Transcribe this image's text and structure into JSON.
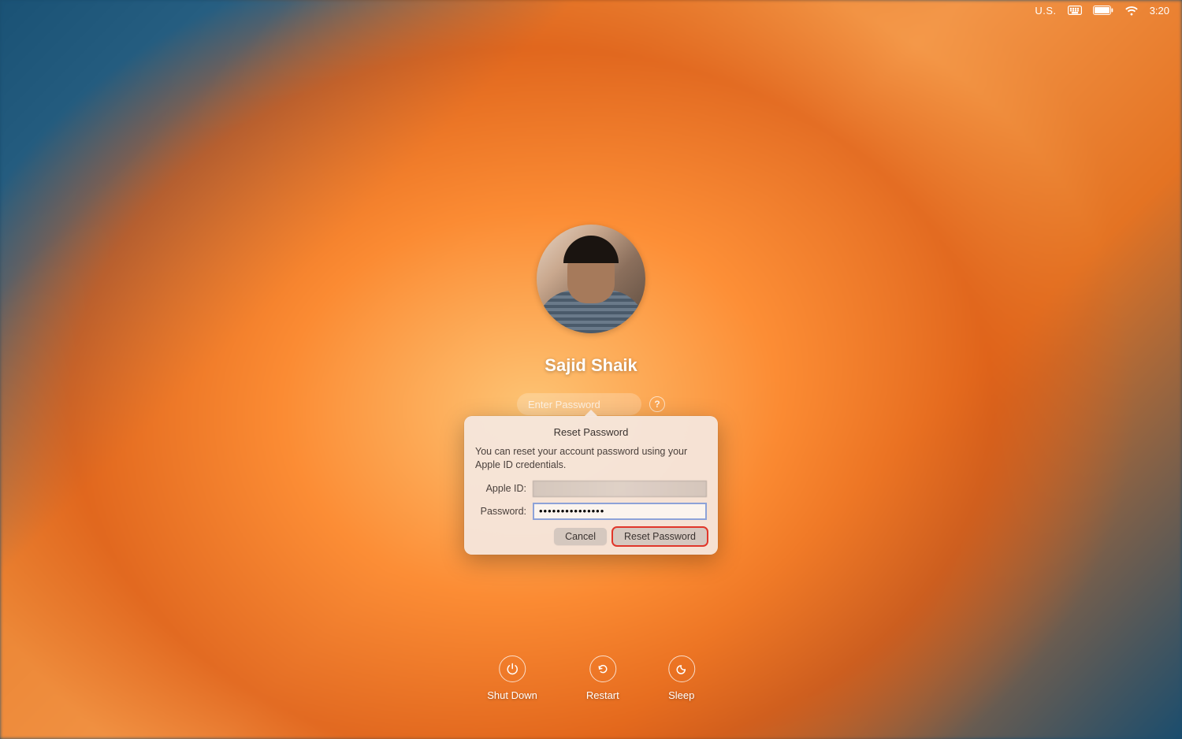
{
  "menuBar": {
    "inputLanguage": "U.S.",
    "time": "3:20"
  },
  "login": {
    "username": "Sajid Shaik",
    "passwordPlaceholder": "Enter Password",
    "helpLabel": "?"
  },
  "resetPopover": {
    "title": "Reset Password",
    "description": "You can reset your account password using your Apple ID credentials.",
    "appleIdLabel": "Apple ID:",
    "appleIdValue": "",
    "passwordLabel": "Password:",
    "passwordValue": "•••••••••••••••",
    "cancelButton": "Cancel",
    "resetButton": "Reset Password"
  },
  "bottomActions": {
    "shutdown": "Shut Down",
    "restart": "Restart",
    "sleep": "Sleep"
  }
}
